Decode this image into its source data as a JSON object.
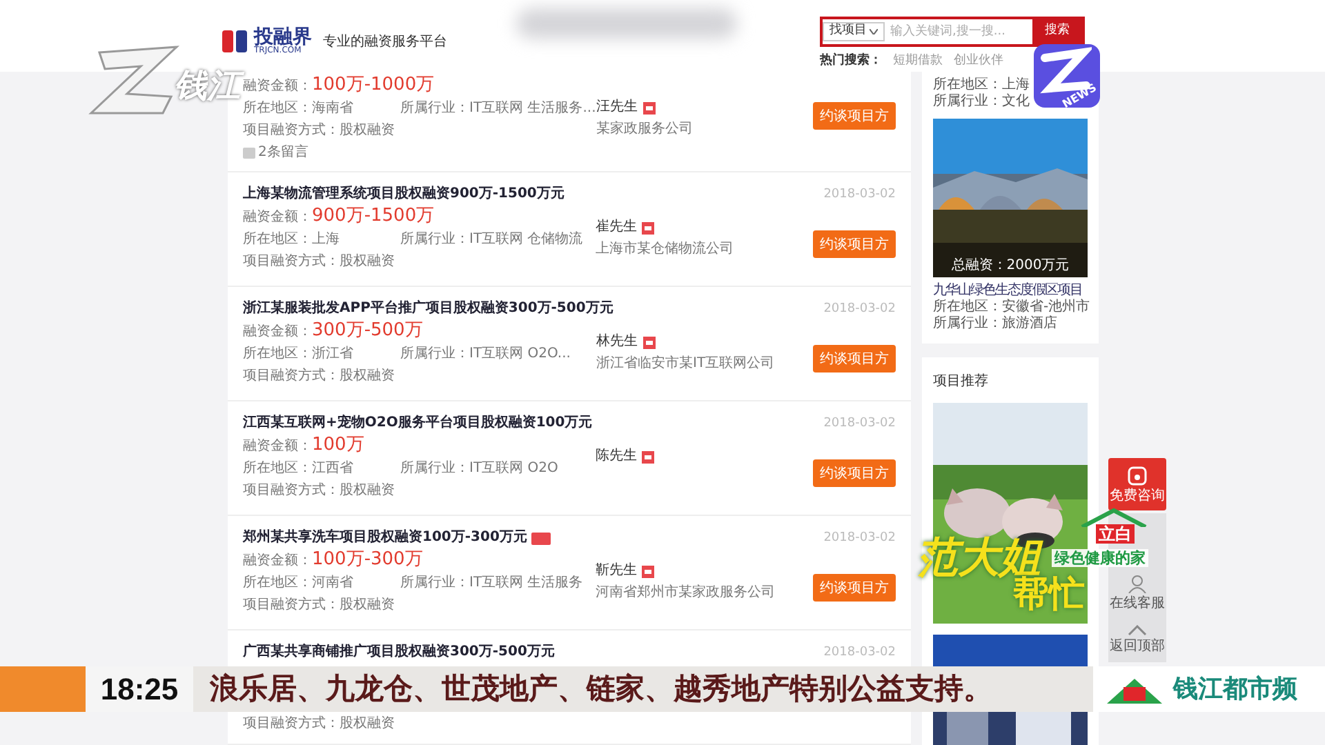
{
  "site": {
    "header": {
      "logo_name": "投融界",
      "logo_domain": "TRJCN.COM",
      "slogan": "专业的融资服务平台",
      "search": {
        "category": "找项目",
        "placeholder": "输入关键词,搜一搜...",
        "button": "搜索"
      },
      "hot_label": "热门搜索：",
      "hot_terms": [
        "短期借款",
        "创业伙伴"
      ]
    },
    "listings": [
      {
        "amount_label": "融资金额：",
        "amount": "100万-1000万",
        "region": "所在地区：海南省",
        "industry": "所属行业：IT互联网 生活服务...",
        "method": "项目融资方式：股权融资",
        "contact": "汪先生",
        "company": "某家政服务公司",
        "button": "约谈项目方",
        "comments": "2条留言"
      },
      {
        "title": "上海某物流管理系统项目股权融资900万-1500万元",
        "date": "2018-03-02",
        "amount_label": "融资金额：",
        "amount": "900万-1500万",
        "region": "所在地区：上海",
        "industry": "所属行业：IT互联网 仓储物流",
        "method": "项目融资方式：股权融资",
        "contact": "崔先生",
        "company": "上海市某仓储物流公司",
        "button": "约谈项目方"
      },
      {
        "title": "浙江某服装批发APP平台推广项目股权融资300万-500万元",
        "date": "2018-03-02",
        "amount_label": "融资金额：",
        "amount": "300万-500万",
        "region": "所在地区：浙江省",
        "industry": "所属行业：IT互联网 O2O...",
        "method": "项目融资方式：股权融资",
        "contact": "林先生",
        "company": "浙江省临安市某IT互联网公司",
        "button": "约谈项目方"
      },
      {
        "title": "江西某互联网+宠物O2O服务平台项目股权融资100万元",
        "date": "2018-03-02",
        "amount_label": "融资金额：",
        "amount": "100万",
        "region": "所在地区：江西省",
        "industry": "所属行业：IT互联网 O2O",
        "method": "项目融资方式：股权融资",
        "contact": "陈先生",
        "button": "约谈项目方"
      },
      {
        "title": "郑州某共享洗车项目股权融资100万-300万元",
        "date": "2018-03-02",
        "amount_label": "融资金额：",
        "amount": "100万-300万",
        "region": "所在地区：河南省",
        "industry": "所属行业：IT互联网 生活服务",
        "method": "项目融资方式：股权融资",
        "contact": "靳先生",
        "company": "河南省郑州市某家政服务公司",
        "button": "约谈项目方",
        "tagged": true
      },
      {
        "title": "广西某共享商铺推广项目股权融资300万-500万元",
        "date": "2018-03-02",
        "method": "项目融资方式：股权融资"
      }
    ],
    "sidebar": {
      "top_region": "所在地区：上海",
      "top_industry": "所属行业：文化",
      "project": {
        "caption": "总融资：2000万元",
        "title": "九华山绿色生态度假区项目",
        "region": "所在地区：安徽省-池州市",
        "industry": "所属行业：旅游酒店"
      },
      "section_title": "项目推荐"
    },
    "float_bar": {
      "consult": "免费咨询",
      "service": "在线客服",
      "top": "返回顶部"
    }
  },
  "tv_overlay": {
    "channel_logo": "钱江",
    "news_logo": "NEWS",
    "show_logo": {
      "title": "范大姐",
      "title_2": "帮忙",
      "sponsor": "立白",
      "slogan": "绿色健康的家"
    },
    "ticker": {
      "time": "18:25",
      "text": "浪乐居、九龙仓、世茂地产、链家、越秀地产特别公益支持。",
      "channel": "钱江都市频"
    }
  }
}
